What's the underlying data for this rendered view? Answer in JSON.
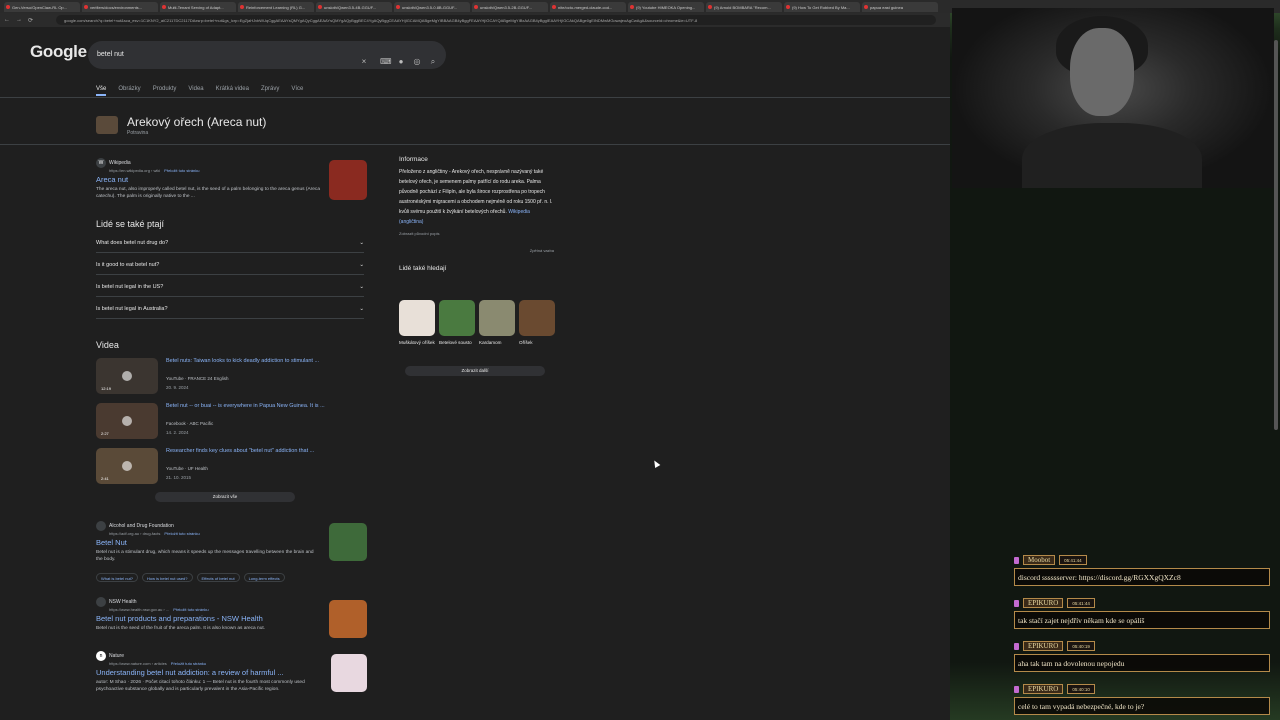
{
  "tabs": [
    "Gen-Verso/OpenClaw-RL Op...",
    "verifiers/docs/environments...",
    "Multi-Tenant Serving of Adapt...",
    "Reinforcement Learning (RL) G...",
    "unsloth/Qwen3.5-4B-GGUF...",
    "unsloth/Qwen3.5-0.8B-GGUF...",
    "unsloth/Qwen3.5-2B-GGUF...",
    "nite/octo-merged-claude-cod...",
    "(9) Youtube HIMEOKA Opening...",
    "(9) Arnold BOMBARA \"Recom...",
    "(9) How To Get Robbed By Ma...",
    "papua east guinea"
  ],
  "browser": {
    "url": "google.com/search?q=betel+nut&sca_esv=1C1KNY2_aiC2117DC2117DAxsrp=betel+nut&gs_lcrp=EgZjaHJvbWUqCggAEAAYsQMYgAQyCggAEAAYsQMYgAQyBggBEC4YgAQyBggCEAAYHjIGCAMQABgeMgYIBBAAGB4yBggFEAAYHjIGCAYQABgeMgYIBxAAGB4yBggIEAAYHjIGCAkQABge0gEINDMwMGowajeoAgCwAgA&sourceid=chrome&ie=UTF-8"
  },
  "google": {
    "logo": "Google",
    "query": "betel nut",
    "nav_tabs": [
      "Vše",
      "Obrázky",
      "Produkty",
      "Videa",
      "Krátká videa",
      "Zprávy",
      "Více"
    ]
  },
  "entity": {
    "title": "Arekový ořech (Areca nut)",
    "subtitle": "Potravina"
  },
  "results": [
    {
      "source": "Wikipedia",
      "url": "https://en.wikipedia.org › wiki",
      "translate": "Přeložit tuto stránku",
      "title": "Areca nut",
      "snippet": "The areca nut, also improperly called betel nut, is the seed of a palm belonging to the areca genus (Areca catechu). The palm is originally native to the ..."
    },
    {
      "source": "Alcohol and Drug Foundation",
      "url": "https://adf.org.au › drug-facts",
      "translate": "Přeložit tuto stránku",
      "title": "Betel Nut",
      "snippet": "Betel nut is a stimulant drug, which means it speeds up the messages travelling between the brain and the body."
    },
    {
      "source": "NSW Health",
      "url": "https://www.health.nsw.gov.au › ...",
      "translate": "Přeložit tuto stránku",
      "title": "Betel nut products and preparations - NSW Health",
      "snippet": "Betel nut is the seed of the fruit of the areca palm. It is also known as areca nut."
    },
    {
      "source": "Nature",
      "url": "https://www.nature.com › articles",
      "translate": "Přeložit tuto stránku",
      "title": "Understanding betel nut addiction: a review of harmful ...",
      "snippet": "autor: M Shao · 2026 · Počet citací tohoto článku: 1 — Betel nut is the fourth most commonly used psychoactive substance globally and is particularly prevalent in the Asia-Pacific region."
    }
  ],
  "adf_chips": [
    "What is betel nut?",
    "How is betel nut used?",
    "Effects of betel nut",
    "Long-term effects"
  ],
  "paa": {
    "heading": "Lidé se také ptají",
    "questions": [
      "What does betel nut drug do?",
      "Is it good to eat betel nut?",
      "Is betel nut legal in the US?",
      "Is betel nut legal in Australia?"
    ]
  },
  "videos": {
    "heading": "Videa",
    "items": [
      {
        "title": "Betel nuts: Taiwan looks to kick deadly addiction to stimulant ...",
        "source": "YouTube · FRANCE 24 English",
        "date": "20. 9. 2024",
        "duration": "12:19"
      },
      {
        "title": "Betel nut -- or buai -- is everywhere in Papua New Guinea. It is ...",
        "source": "Facebook · ABC Pacific",
        "date": "14. 2. 2024",
        "duration": "2:27"
      },
      {
        "title": "Researcher finds key clues about \"betel nut\" addiction that ...",
        "source": "YouTube · UF Health",
        "date": "21. 10. 2015",
        "duration": "2:41"
      }
    ],
    "show_all": "Zobrazit vše"
  },
  "knowledge_panel": {
    "heading": "Informace",
    "text": "Přeloženo z angličtiny - Arekový ořech, nesprávně nazývaný také betelový ořech, je semenem palmy patřící do rodu areka. Palma původně pochází z Filipín, ale byla široce rozprostřena po tropech austronéskými migracemi a obchodem nejméně od roku 1500 př. n. l. kvůli svému použití k žvýkání betelových ořechů.",
    "link": "Wikipedia (angličtina)",
    "original": "Zobrazit původní popis",
    "feedback": "Zpětná vazba",
    "also_search": "Lidé také hledají",
    "also_items": [
      "Muškátový oříšek",
      "Betelové sousto",
      "Kardamom",
      "Oříšek"
    ],
    "more": "Zobrazit další"
  },
  "chat": [
    {
      "name": "Moobot",
      "time": "05:41:44",
      "msg": "discord sssssserver: https://discord.gg/RGXXgQXZc8"
    },
    {
      "name": "EPIKURO",
      "time": "05:41:44",
      "msg": "tak stačí zajet nejdřív někam kde se opálíš"
    },
    {
      "name": "EPIKURO",
      "time": "05:40:19",
      "msg": "aha tak tam na dovolenou nepojedu"
    },
    {
      "name": "EPIKURO",
      "time": "05:40:10",
      "msg": "celé to tam vypadá nebezpečné, kde to je?"
    }
  ]
}
